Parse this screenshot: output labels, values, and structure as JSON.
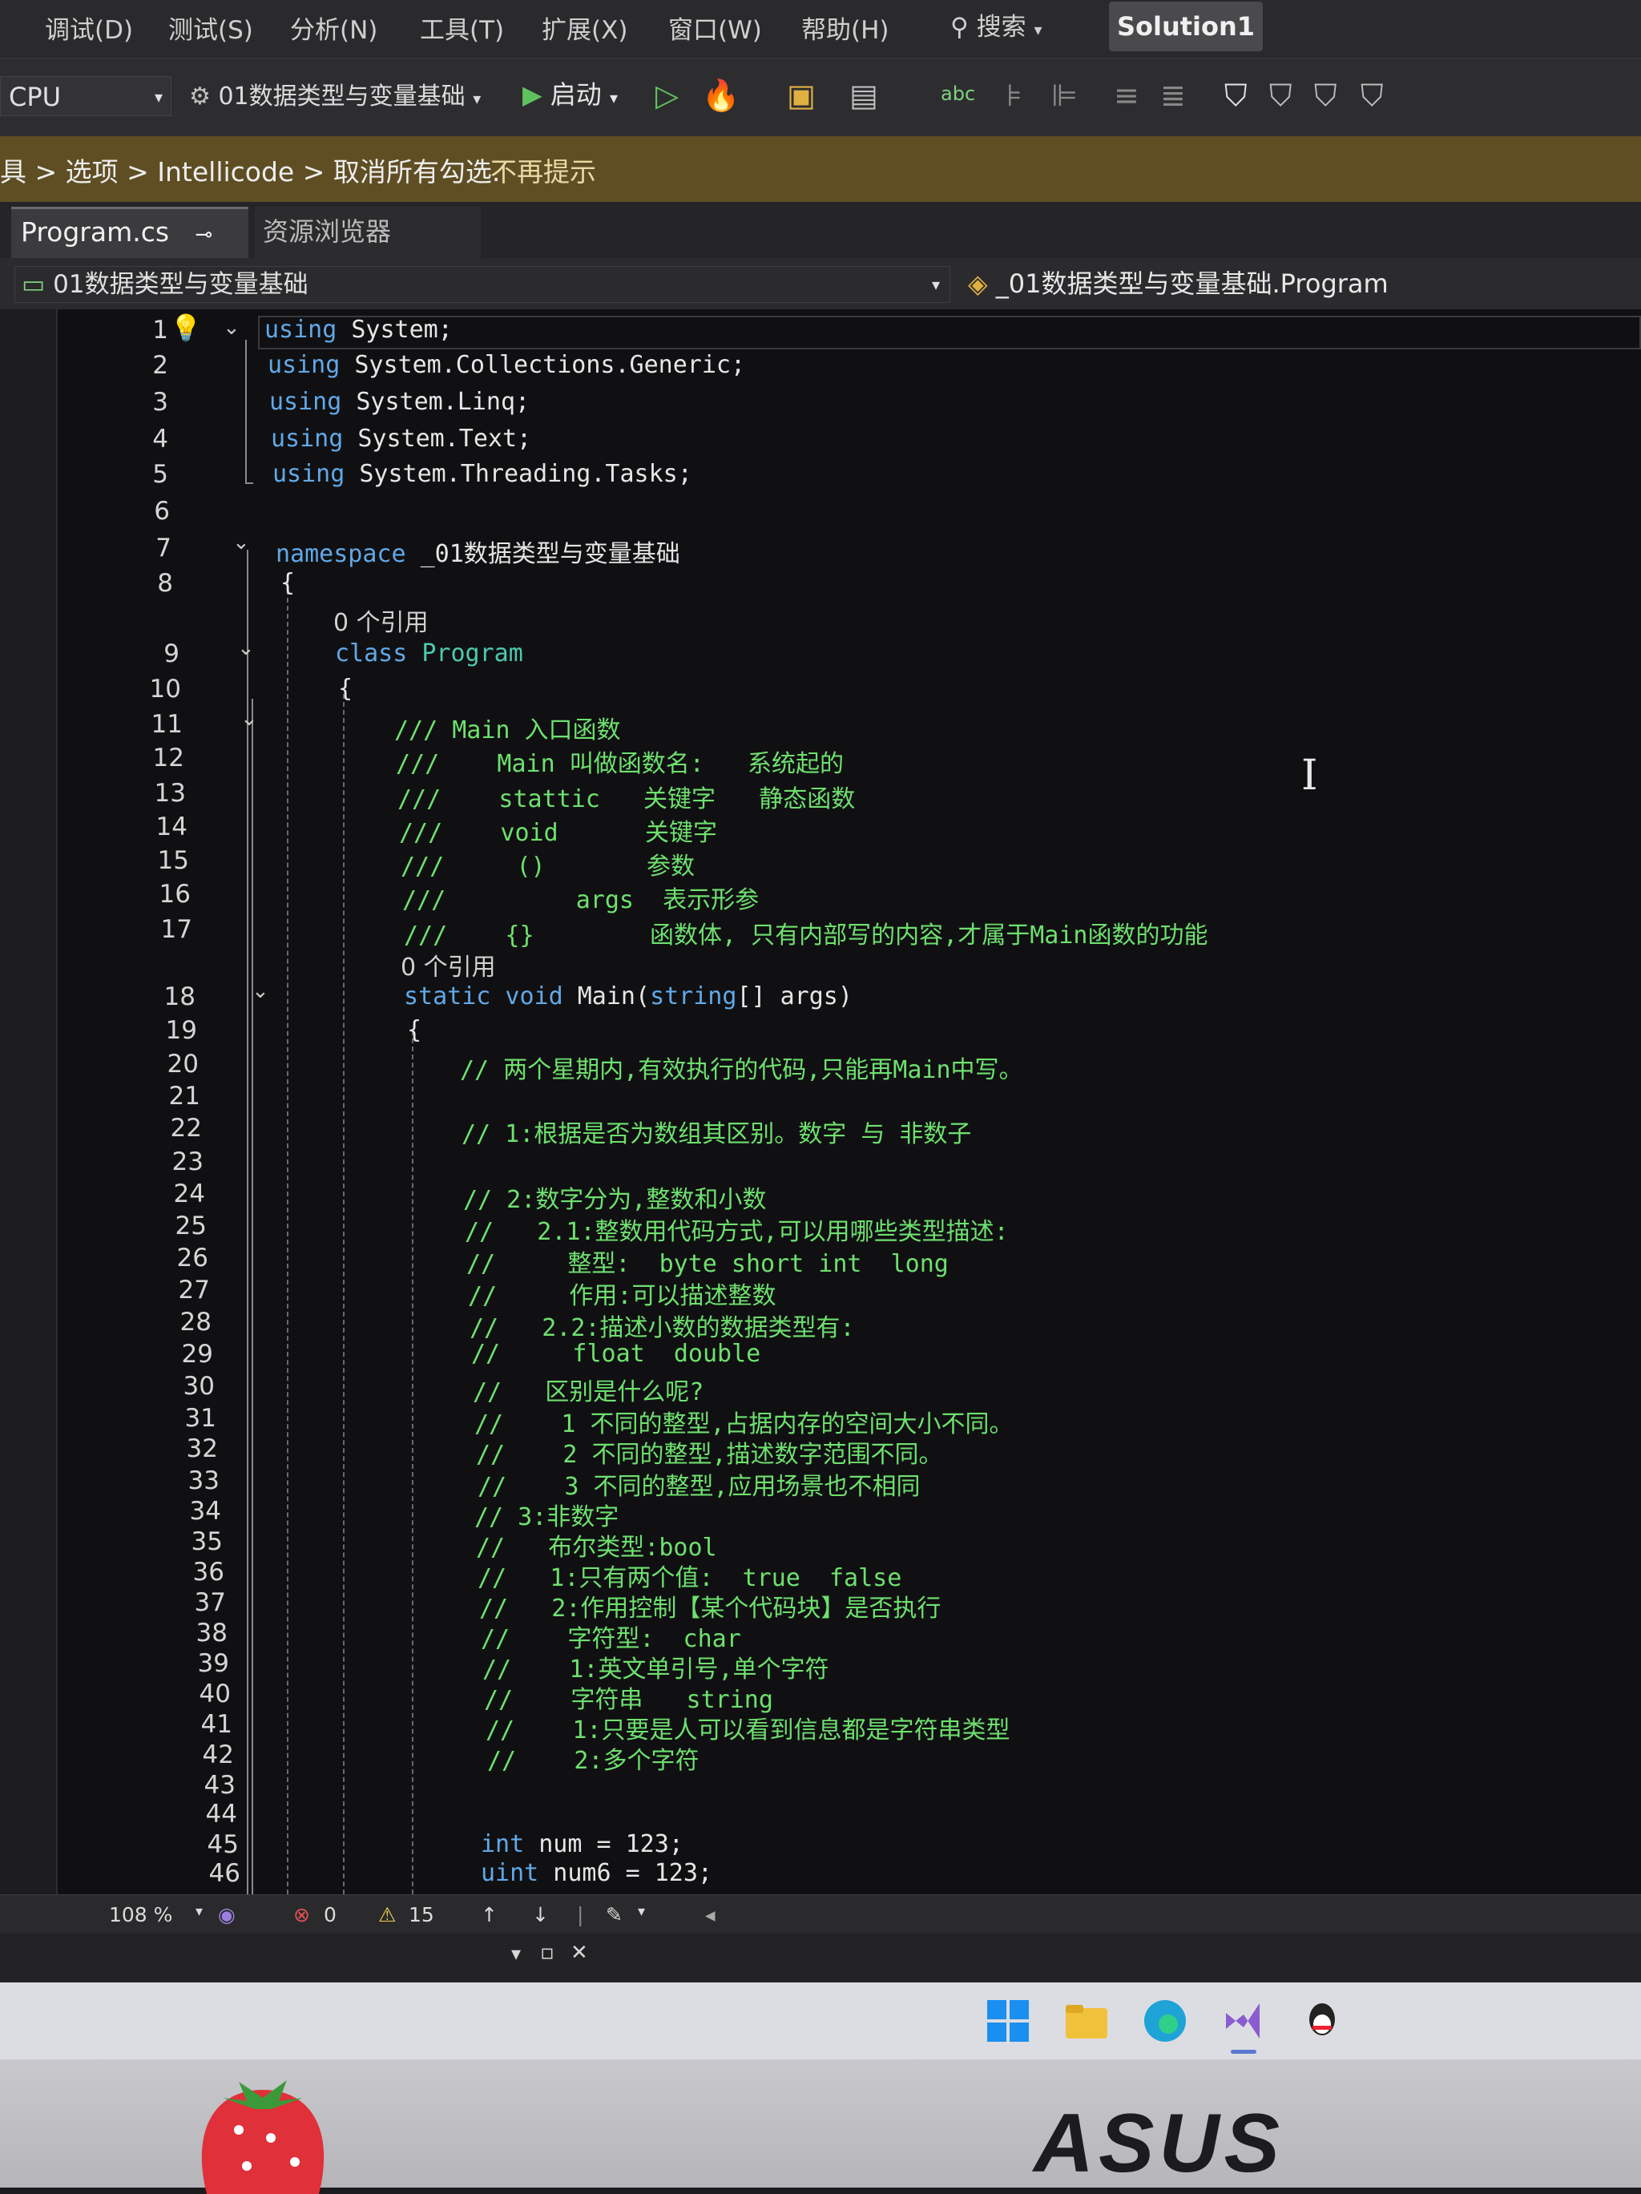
{
  "menubar": {
    "items": [
      "调试(D)",
      "测试(S)",
      "分析(N)",
      "工具(T)",
      "扩展(X)",
      "窗口(W)",
      "帮助(H)"
    ],
    "search_label": "搜索",
    "solution_name": "Solution1"
  },
  "toolbar": {
    "platform": "CPU",
    "project": "01数据类型与变量基础",
    "start_label": "启动"
  },
  "infobar": {
    "path": "具 > 选项 > Intellicode > 取消所有勾选.",
    "dismiss_link": "不再提示"
  },
  "tabs": [
    {
      "label": "Program.cs",
      "active": true
    },
    {
      "label": "资源浏览器",
      "active": false
    }
  ],
  "navbar": {
    "project": "01数据类型与变量基础",
    "class": "_01数据类型与变量基础.Program"
  },
  "code": {
    "ref_label": "0 个引用",
    "l1_kw": "using",
    "l1_tx": " System;",
    "l2_kw": "using",
    "l2_tx": " System.Collections.Generic;",
    "l3_kw": "using",
    "l3_tx": " System.Linq;",
    "l4_kw": "using",
    "l4_tx": " System.Text;",
    "l5_kw": "using",
    "l5_tx": " System.Threading.Tasks;",
    "l7_kw": "namespace",
    "l7_tx": " _01数据类型与变量基础",
    "brace_open": "{",
    "l9_kw": "class",
    "l9_ty": " Program",
    "l11": "/// Main 入口函数",
    "l12": "///    Main 叫做函数名:   系统起的",
    "l13": "///    stattic   关键字   静态函数",
    "l14": "///    void      关键字",
    "l15": "///     ()       参数",
    "l16": "///         args  表示形参",
    "l17": "///    {}        函数体, 只有内部写的内容,才属于Main函数的功能",
    "l18_kw": "static void",
    "l18_tx": " Main(",
    "l18_kw2": "string",
    "l18_tx2": "[] args)",
    "l20": "// 两个星期内,有效执行的代码,只能再Main中写。",
    "l22": "// 1:根据是否为数组其区别。数字 与 非数子",
    "l24": "// 2:数字分为,整数和小数",
    "l25": "//   2.1:整数用代码方式,可以用哪些类型描述:",
    "l26": "//     整型:  byte short int  long",
    "l27": "//     作用:可以描述整数",
    "l28": "//   2.2:描述小数的数据类型有:",
    "l29": "//     float  double",
    "l30": "//   区别是什么呢?",
    "l31": "//    1 不同的整型,占据内存的空间大小不同。",
    "l32": "//    2 不同的整型,描述数字范围不同。",
    "l33": "//    3 不同的整型,应用场景也不相同",
    "l34": "// 3:非数字",
    "l35": "//   布尔类型:bool",
    "l36": "//   1:只有两个值:  true  false",
    "l37": "//   2:作用控制【某个代码块】是否执行",
    "l38": "//    字符型:  char",
    "l39": "//    1:英文单引号,单个字符",
    "l40": "//    字符串   string",
    "l41": "//    1:只要是人可以看到信息都是字符串类型",
    "l42": "//    2:多个字符",
    "l45_kw": "int",
    "l45_tx": " num = 123;",
    "l46_kw": "uint",
    "l46_tx": " num6 = 123;"
  },
  "statusbar": {
    "zoom": "108 %",
    "errors": "0",
    "warnings": "15"
  },
  "monitor_brand": "ASUS"
}
